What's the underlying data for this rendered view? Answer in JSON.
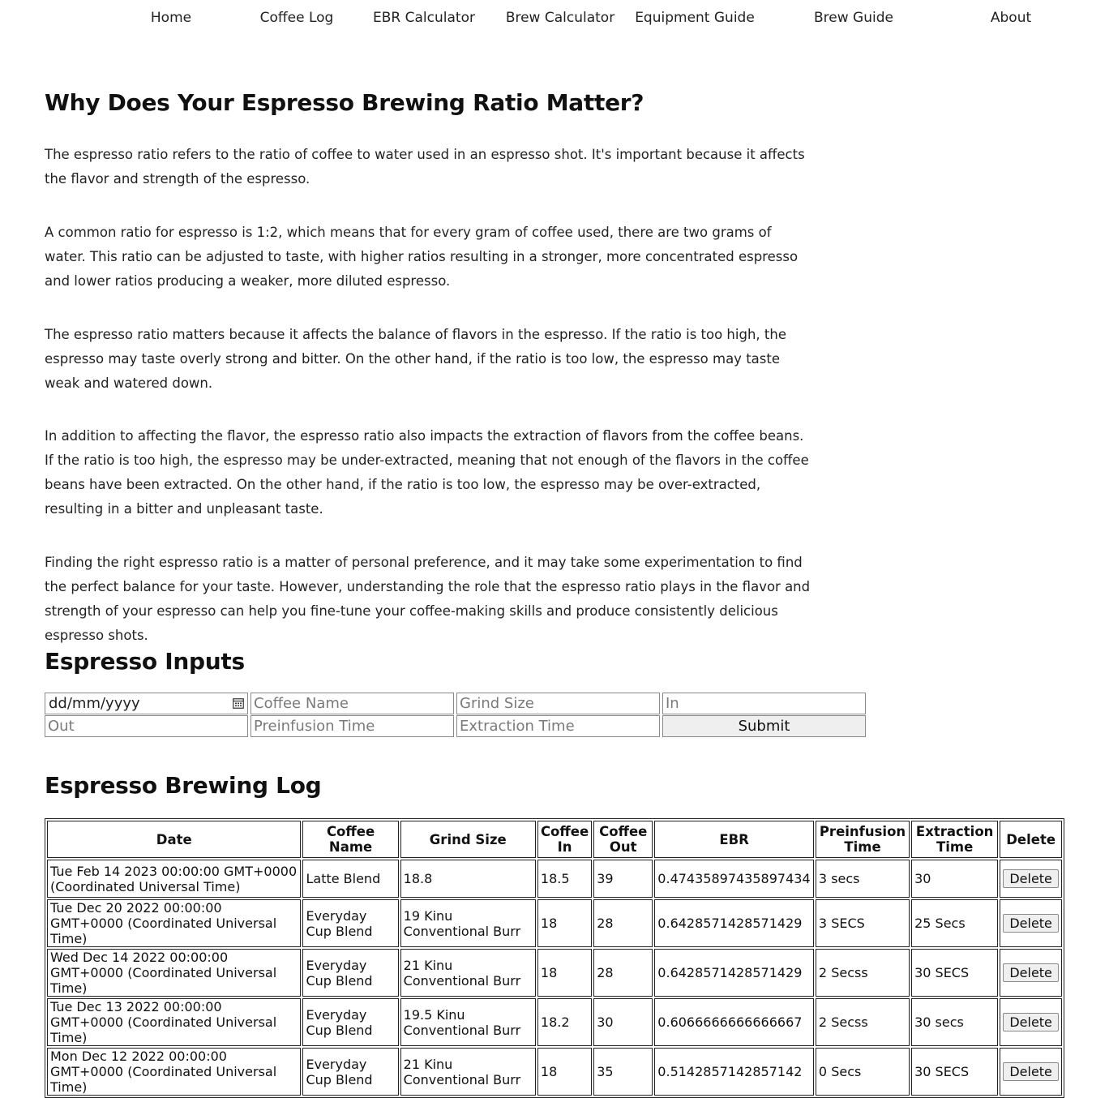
{
  "nav": {
    "items": [
      "Home",
      "Coffee Log",
      "EBR Calculator",
      "Brew Calculator",
      "Equipment Guide",
      "Brew Guide",
      "About"
    ]
  },
  "article": {
    "title": "Why Does Your Espresso Brewing Ratio Matter?",
    "paragraphs": [
      "The espresso ratio refers to the ratio of coffee to water used in an espresso shot. It's important because it affects the flavor and strength of the espresso.",
      "A common ratio for espresso is 1:2, which means that for every gram of coffee used, there are two grams of water. This ratio can be adjusted to taste, with higher ratios resulting in a stronger, more concentrated espresso and lower ratios producing a weaker, more diluted espresso.",
      "The espresso ratio matters because it affects the balance of flavors in the espresso. If the ratio is too high, the espresso may taste overly strong and bitter. On the other hand, if the ratio is too low, the espresso may taste weak and watered down.",
      "In addition to affecting the flavor, the espresso ratio also impacts the extraction of flavors from the coffee beans. If the ratio is too high, the espresso may be under-extracted, meaning that not enough of the flavors in the coffee beans have been extracted. On the other hand, if the ratio is too low, the espresso may be over-extracted, resulting in a bitter and unpleasant taste.",
      "Finding the right espresso ratio is a matter of personal preference, and it may take some experimentation to find the perfect balance for your taste. However, understanding the role that the espresso ratio plays in the flavor and strength of your espresso can help you fine-tune your coffee-making skills and produce consistently delicious espresso shots."
    ]
  },
  "inputs": {
    "title": "Espresso Inputs",
    "date_placeholder": "dd/mm/yyyy",
    "coffee_name_placeholder": "Coffee Name",
    "grind_size_placeholder": "Grind Size",
    "in_placeholder": "In",
    "out_placeholder": "Out",
    "preinfusion_placeholder": "Preinfusion Time",
    "extraction_placeholder": "Extraction Time",
    "submit_label": "Submit",
    "calendar_icon": "calendar-icon"
  },
  "log": {
    "title": "Espresso Brewing Log",
    "headers": {
      "date": "Date",
      "coffee_name": "Coffee Name",
      "grind_size": "Grind Size",
      "coffee_in": "Coffee In",
      "coffee_out": "Coffee Out",
      "ebr": "EBR",
      "preinfusion": "Preinfusion Time",
      "extraction": "Extraction Time",
      "delete": "Delete"
    },
    "rows": [
      {
        "date": "Tue Feb 14 2023 00:00:00 GMT+0000 (Coordinated Universal Time)",
        "coffee_name": "Latte Blend",
        "grind_size": "18.8",
        "coffee_in": "18.5",
        "coffee_out": "39",
        "ebr": "0.47435897435897434",
        "preinfusion": "3 secs",
        "extraction": "30",
        "delete_label": "Delete"
      },
      {
        "date": "Tue Dec 20 2022 00:00:00 GMT+0000 (Coordinated Universal Time)",
        "coffee_name": "Everyday Cup Blend",
        "grind_size": "19 Kinu Conventional Burr",
        "coffee_in": "18",
        "coffee_out": "28",
        "ebr": "0.6428571428571429",
        "preinfusion": "3 SECS",
        "extraction": "25 Secs",
        "delete_label": "Delete"
      },
      {
        "date": "Wed Dec 14 2022 00:00:00 GMT+0000 (Coordinated Universal Time)",
        "coffee_name": "Everyday Cup Blend",
        "grind_size": "21 Kinu Conventional Burr",
        "coffee_in": "18",
        "coffee_out": "28",
        "ebr": "0.6428571428571429",
        "preinfusion": "2 Secss",
        "extraction": "30 SECS",
        "delete_label": "Delete"
      },
      {
        "date": "Tue Dec 13 2022 00:00:00 GMT+0000 (Coordinated Universal Time)",
        "coffee_name": "Everyday Cup Blend",
        "grind_size": "19.5 Kinu Conventional Burr",
        "coffee_in": "18.2",
        "coffee_out": "30",
        "ebr": "0.6066666666666667",
        "preinfusion": "2 Secss",
        "extraction": "30 secs",
        "delete_label": "Delete"
      },
      {
        "date": "Mon Dec 12 2022 00:00:00 GMT+0000 (Coordinated Universal Time)",
        "coffee_name": "Everyday Cup Blend",
        "grind_size": "21 Kinu Conventional Burr",
        "coffee_in": "18",
        "coffee_out": "35",
        "ebr": "0.5142857142857142",
        "preinfusion": "0 Secs",
        "extraction": "30 SECS",
        "delete_label": "Delete"
      }
    ]
  }
}
